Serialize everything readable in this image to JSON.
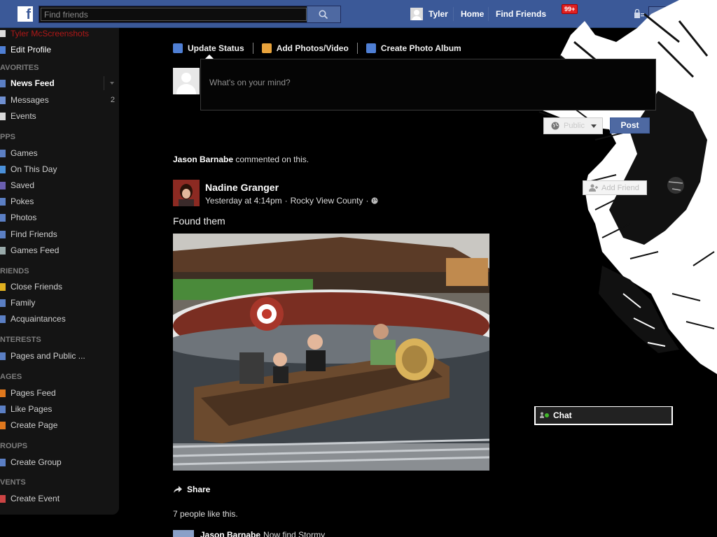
{
  "topbar": {
    "logo": "f",
    "search_placeholder": "Find friends",
    "user_name": "Tyler",
    "home_label": "Home",
    "find_friends_label": "Find Friends",
    "notif_badge": "99+"
  },
  "sidebar": {
    "profile_name": "Tyler McScreenshots",
    "edit_profile": "Edit Profile",
    "sections": {
      "favorites": "AVORITES",
      "apps": "PPS",
      "friends": "RIENDS",
      "interests": "NTERESTS",
      "pages": "AGES",
      "groups": "ROUPS",
      "events": "VENTS"
    },
    "items": {
      "news_feed": "News Feed",
      "messages": "Messages",
      "messages_count": "2",
      "events": "Events",
      "games": "Games",
      "on_this_day": "On This Day",
      "saved": "Saved",
      "pokes": "Pokes",
      "photos": "Photos",
      "find_friends": "Find Friends",
      "games_feed": "Games Feed",
      "close_friends": "Close Friends",
      "family": "Family",
      "acquaintances": "Acquaintances",
      "pages_public": "Pages and Public ...",
      "pages_feed": "Pages Feed",
      "like_pages": "Like Pages",
      "create_page": "Create Page",
      "create_group": "Create Group",
      "create_event": "Create Event"
    }
  },
  "composer": {
    "tab_status": "Update Status",
    "tab_photos": "Add Photos/Video",
    "tab_album": "Create Photo Album",
    "placeholder": "What's on your mind?",
    "privacy": "Public",
    "post_label": "Post"
  },
  "story": {
    "activity_actor": "Jason Barnabe",
    "activity_text": " commented on this.",
    "author": "Nadine Granger",
    "time": "Yesterday at 4:14pm",
    "location": "Rocky View County",
    "text": "Found them",
    "share_label": "Share",
    "likes": "7 people like this.",
    "comment_author": "Jason Barnabe",
    "comment_text": "Now find Stormy"
  },
  "right": {
    "add_friend": "Add Friend",
    "chat": "Chat"
  },
  "colors": {
    "brand": "#3b5998",
    "button": "#4e69a2",
    "badge": "#e02020"
  }
}
